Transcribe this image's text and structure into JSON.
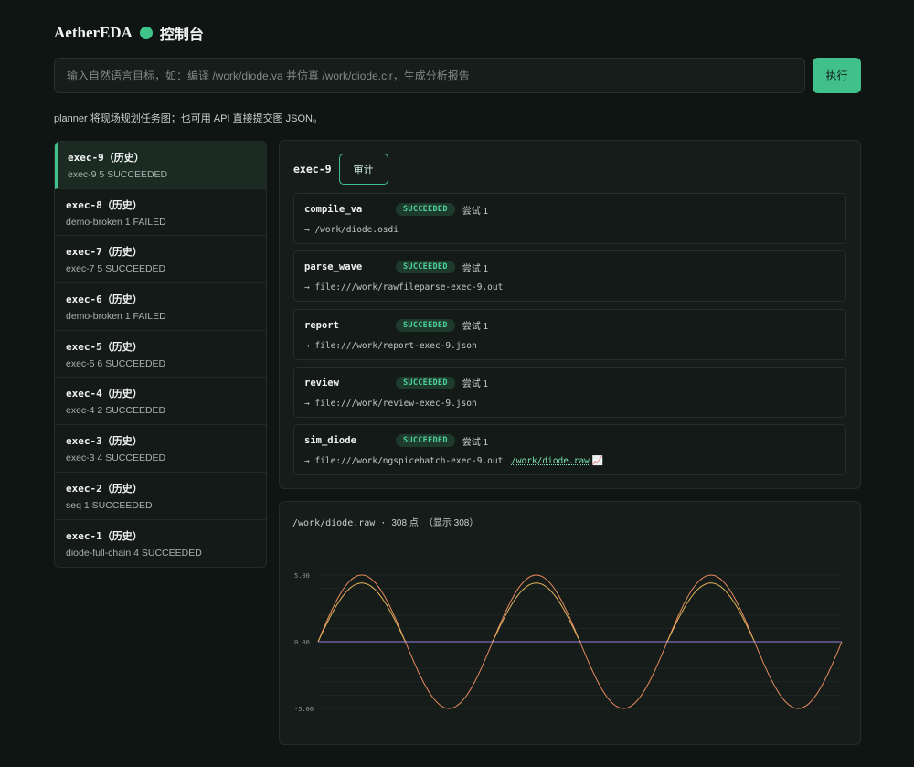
{
  "header": {
    "brand": "AetherEDA",
    "subtitle": "控制台",
    "status_color": "#3fc48a"
  },
  "goal": {
    "placeholder": "输入自然语言目标，如：编译 /work/diode.va 并仿真 /work/diode.cir，生成分析报告",
    "value": ""
  },
  "run_label": "执行",
  "hint": "planner 将现场规划任务图；也可用 API 直接提交图 JSON。",
  "history": [
    {
      "id": "exec-9",
      "tag": "（历史）",
      "summary": "exec-9 5 SUCCEEDED",
      "active": true
    },
    {
      "id": "exec-8",
      "tag": "（历史）",
      "summary": "demo-broken 1 FAILED"
    },
    {
      "id": "exec-7",
      "tag": "（历史）",
      "summary": "exec-7 5 SUCCEEDED"
    },
    {
      "id": "exec-6",
      "tag": "（历史）",
      "summary": "demo-broken 1 FAILED"
    },
    {
      "id": "exec-5",
      "tag": "（历史）",
      "summary": "exec-5 6 SUCCEEDED"
    },
    {
      "id": "exec-4",
      "tag": "（历史）",
      "summary": "exec-4 2 SUCCEEDED"
    },
    {
      "id": "exec-3",
      "tag": "（历史）",
      "summary": "exec-3 4 SUCCEEDED"
    },
    {
      "id": "exec-2",
      "tag": "（历史）",
      "summary": "seq 1 SUCCEEDED"
    },
    {
      "id": "exec-1",
      "tag": "（历史）",
      "summary": "diode-full-chain 4 SUCCEEDED"
    }
  ],
  "detail": {
    "exec_id": "exec-9",
    "review_label": "审计",
    "tasks": [
      {
        "name": "compile_va",
        "status": "SUCCEEDED",
        "attempt": "尝试 1",
        "output": "→ /work/diode.osdi"
      },
      {
        "name": "parse_wave",
        "status": "SUCCEEDED",
        "attempt": "尝试 1",
        "output": "→ file:///work/rawfileparse-exec-9.out"
      },
      {
        "name": "report",
        "status": "SUCCEEDED",
        "attempt": "尝试 1",
        "output": "→ file:///work/report-exec-9.json"
      },
      {
        "name": "review",
        "status": "SUCCEEDED",
        "attempt": "尝试 1",
        "output": "→ file:///work/review-exec-9.json"
      },
      {
        "name": "sim_diode",
        "status": "SUCCEEDED",
        "attempt": "尝试 1",
        "output": "→ file:///work/ngspicebatch-exec-9.out",
        "link": "/work/diode.raw",
        "link_icon": "📈"
      }
    ]
  },
  "wave": {
    "title_path": "/work/diode.raw",
    "title_sep": " · ",
    "title_points": "308 点",
    "title_shown": "（显示 308）"
  },
  "chart_data": {
    "type": "line",
    "points": 308,
    "ylim": [
      -5.0,
      5.0
    ],
    "yticks": [
      "5.00",
      "0.00",
      "-5.00"
    ],
    "cycles": 3,
    "series": [
      {
        "color": "#e88a5e",
        "amplitude": 5.0,
        "shape": "sine"
      },
      {
        "color": "#e4b45c",
        "amplitude": 4.4,
        "shape": "half-wave-rectified"
      },
      {
        "color": "#9a7fe0",
        "amplitude": 0.0,
        "shape": "flat"
      }
    ],
    "grid": true
  }
}
